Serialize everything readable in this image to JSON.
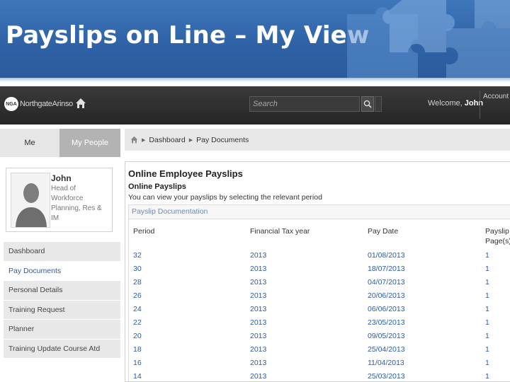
{
  "slide": {
    "title": "Payslips on Line – My View"
  },
  "header": {
    "logo_badge": "NGA",
    "logo_text": "NorthgateArinso",
    "search_placeholder": "Search",
    "welcome_prefix": "Welcome,",
    "welcome_name": "John",
    "account_label": "Account"
  },
  "sidebar": {
    "tabs": [
      {
        "label": "Me"
      },
      {
        "label": "My People"
      }
    ],
    "profile": {
      "name": "John",
      "role": "Head of Workforce Planning, Res & IM"
    },
    "items": [
      {
        "label": "Dashboard"
      },
      {
        "label": "Pay Documents"
      },
      {
        "label": "Personal Details"
      },
      {
        "label": "Training Request"
      },
      {
        "label": "Planner"
      },
      {
        "label": "Training Update Course Atd"
      }
    ]
  },
  "breadcrumb": {
    "items": [
      "Dashboard",
      "Pay Documents"
    ]
  },
  "main": {
    "title": "Online Employee Payslips",
    "subtitle": "Online Payslips",
    "hint": "You can view your payslips by selecting the relevant period",
    "doc_tab": "Payslip Documentation",
    "columns": [
      "Period",
      "Financial Tax year",
      "Pay Date",
      "Payslip Page(s)"
    ],
    "rows": [
      {
        "period": "32",
        "tax_year": "2013",
        "pay_date": "01/08/2013",
        "pages": "1"
      },
      {
        "period": "30",
        "tax_year": "2013",
        "pay_date": "18/07/2013",
        "pages": "1"
      },
      {
        "period": "28",
        "tax_year": "2013",
        "pay_date": "04/07/2013",
        "pages": "1"
      },
      {
        "period": "26",
        "tax_year": "2013",
        "pay_date": "20/06/2013",
        "pages": "1"
      },
      {
        "period": "24",
        "tax_year": "2013",
        "pay_date": "06/06/2013",
        "pages": "1"
      },
      {
        "period": "22",
        "tax_year": "2013",
        "pay_date": "23/05/2013",
        "pages": "1"
      },
      {
        "period": "20",
        "tax_year": "2013",
        "pay_date": "09/05/2013",
        "pages": "1"
      },
      {
        "period": "18",
        "tax_year": "2013",
        "pay_date": "25/04/2013",
        "pages": "1"
      },
      {
        "period": "16",
        "tax_year": "2013",
        "pay_date": "11/04/2013",
        "pages": "1"
      },
      {
        "period": "14",
        "tax_year": "2013",
        "pay_date": "25/03/2013",
        "pages": "1"
      }
    ]
  },
  "colors": {
    "banner": "#2f63a6",
    "header_bg": "#2b2b2b",
    "link_blue": "#2a5ba8"
  }
}
